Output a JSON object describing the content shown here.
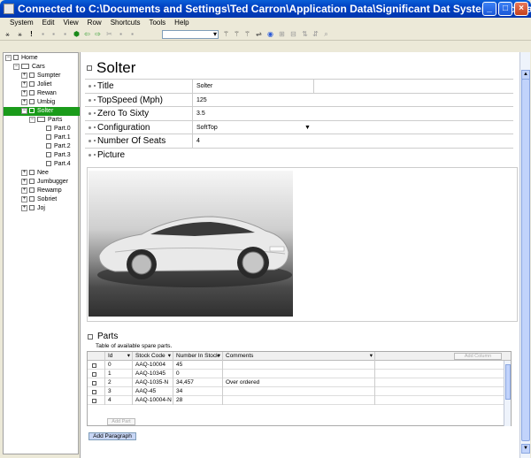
{
  "window": {
    "title": "Connected to C:\\Documents and Settings\\Ted Carron\\Application Data\\Significant Dat Systems Ltd\\Datawasp\\..."
  },
  "menu": [
    "System",
    "Edit",
    "View",
    "Row",
    "Shortcuts",
    "Tools",
    "Help"
  ],
  "tree": {
    "items": [
      {
        "label": "Home"
      },
      {
        "label": "Cars"
      },
      {
        "label": "Sumpter"
      },
      {
        "label": "Joliet"
      },
      {
        "label": "Rewan"
      },
      {
        "label": "Umbig"
      },
      {
        "label": "Solter"
      },
      {
        "label": "Parts"
      },
      {
        "label": "Part.0"
      },
      {
        "label": "Part.1"
      },
      {
        "label": "Part.2"
      },
      {
        "label": "Part.3"
      },
      {
        "label": "Part.4"
      },
      {
        "label": "Nee"
      },
      {
        "label": "Jumbugger"
      },
      {
        "label": "Rewamp"
      },
      {
        "label": "Sobriet"
      },
      {
        "label": "Joj"
      }
    ]
  },
  "page": {
    "title": "Solter",
    "properties": [
      {
        "label": "Title",
        "value": "Solter"
      },
      {
        "label": "TopSpeed (Mph)",
        "value": "125"
      },
      {
        "label": "Zero To Sixty",
        "value": "3.5"
      },
      {
        "label": "Configuration",
        "value": "SoftTop"
      },
      {
        "label": "Number Of Seats",
        "value": "4"
      }
    ],
    "picture_label": "Picture",
    "parts_title": "Parts",
    "parts_desc": "Table of available spare parts.",
    "parts_columns": [
      "Id",
      "Stock Code",
      "Number In Stock",
      "Comments"
    ],
    "parts_rows": [
      [
        "0",
        "AAQ-10004",
        "45",
        ""
      ],
      [
        "1",
        "AAQ-10345",
        "0",
        ""
      ],
      [
        "2",
        "AAQ-1035-N",
        "34,457",
        "Over ordered"
      ],
      [
        "3",
        "AAQ-45",
        "34",
        ""
      ],
      [
        "4",
        "AAQ-10004-N",
        "28",
        ""
      ]
    ],
    "add_column_label": "Add Column",
    "add_part_label": "Add Part",
    "add_paragraph_label": "Add Paragraph"
  },
  "colors": {
    "titlebar": "#0041c2",
    "selection": "#1a9b1a",
    "button": "#c8d6f5"
  }
}
